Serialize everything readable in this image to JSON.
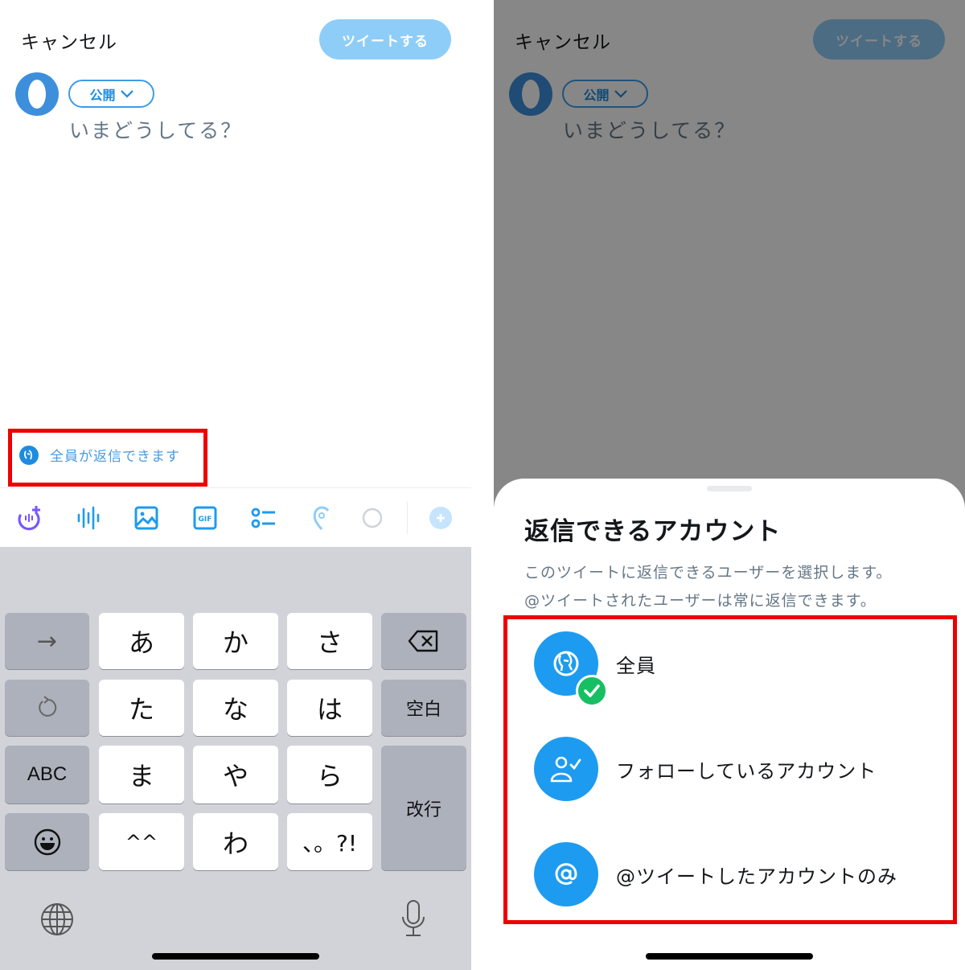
{
  "compose": {
    "cancel_label": "キャンセル",
    "tweet_button_label": "ツイートする",
    "audience_label": "公開",
    "placeholder": "いまどうしてる？",
    "reply_setting_label": "全員が返信できます"
  },
  "toolbar": {
    "icons": [
      "spaces-icon",
      "voice-icon",
      "image-icon",
      "gif-icon",
      "poll-icon",
      "location-icon",
      "char-count-ring-icon",
      "add-thread-icon"
    ]
  },
  "keyboard": {
    "rows": [
      [
        "→",
        "あ",
        "か",
        "さ",
        "⌫"
      ],
      [
        "↺",
        "た",
        "な",
        "は",
        "空白"
      ],
      [
        "ABC",
        "ま",
        "や",
        "ら",
        "改行"
      ],
      [
        "☺",
        "^^",
        "わ",
        "、。?!"
      ]
    ],
    "arrow_key": "→",
    "undo_key": "↺",
    "abc_key": "ABC",
    "space_key": "空白",
    "return_key": "改行",
    "kana": {
      "a": "あ",
      "ka": "か",
      "sa": "さ",
      "ta": "た",
      "na": "な",
      "ha": "は",
      "ma": "ま",
      "ya": "や",
      "ra": "ら",
      "kaomoji": "^^",
      "wa": "わ",
      "punct": "、。?!"
    }
  },
  "reply_sheet": {
    "title": "返信できるアカウント",
    "description_line1": "このツイートに返信できるユーザーを選択します。",
    "description_line2": "@ツイートされたユーザーは常に返信できます。",
    "options": [
      {
        "label": "全員",
        "icon": "globe-icon",
        "selected": true
      },
      {
        "label": "フォローしているアカウント",
        "icon": "person-check-icon",
        "selected": false
      },
      {
        "label": "@ツイートしたアカウントのみ",
        "icon": "at-icon",
        "selected": false
      }
    ]
  },
  "colors": {
    "brand_blue": "#1d9bf0",
    "tweet_button_disabled": "#8ecdf8",
    "highlight_red": "#ee0000",
    "check_green": "#17bf63",
    "keyboard_bg": "#d1d3d9"
  }
}
